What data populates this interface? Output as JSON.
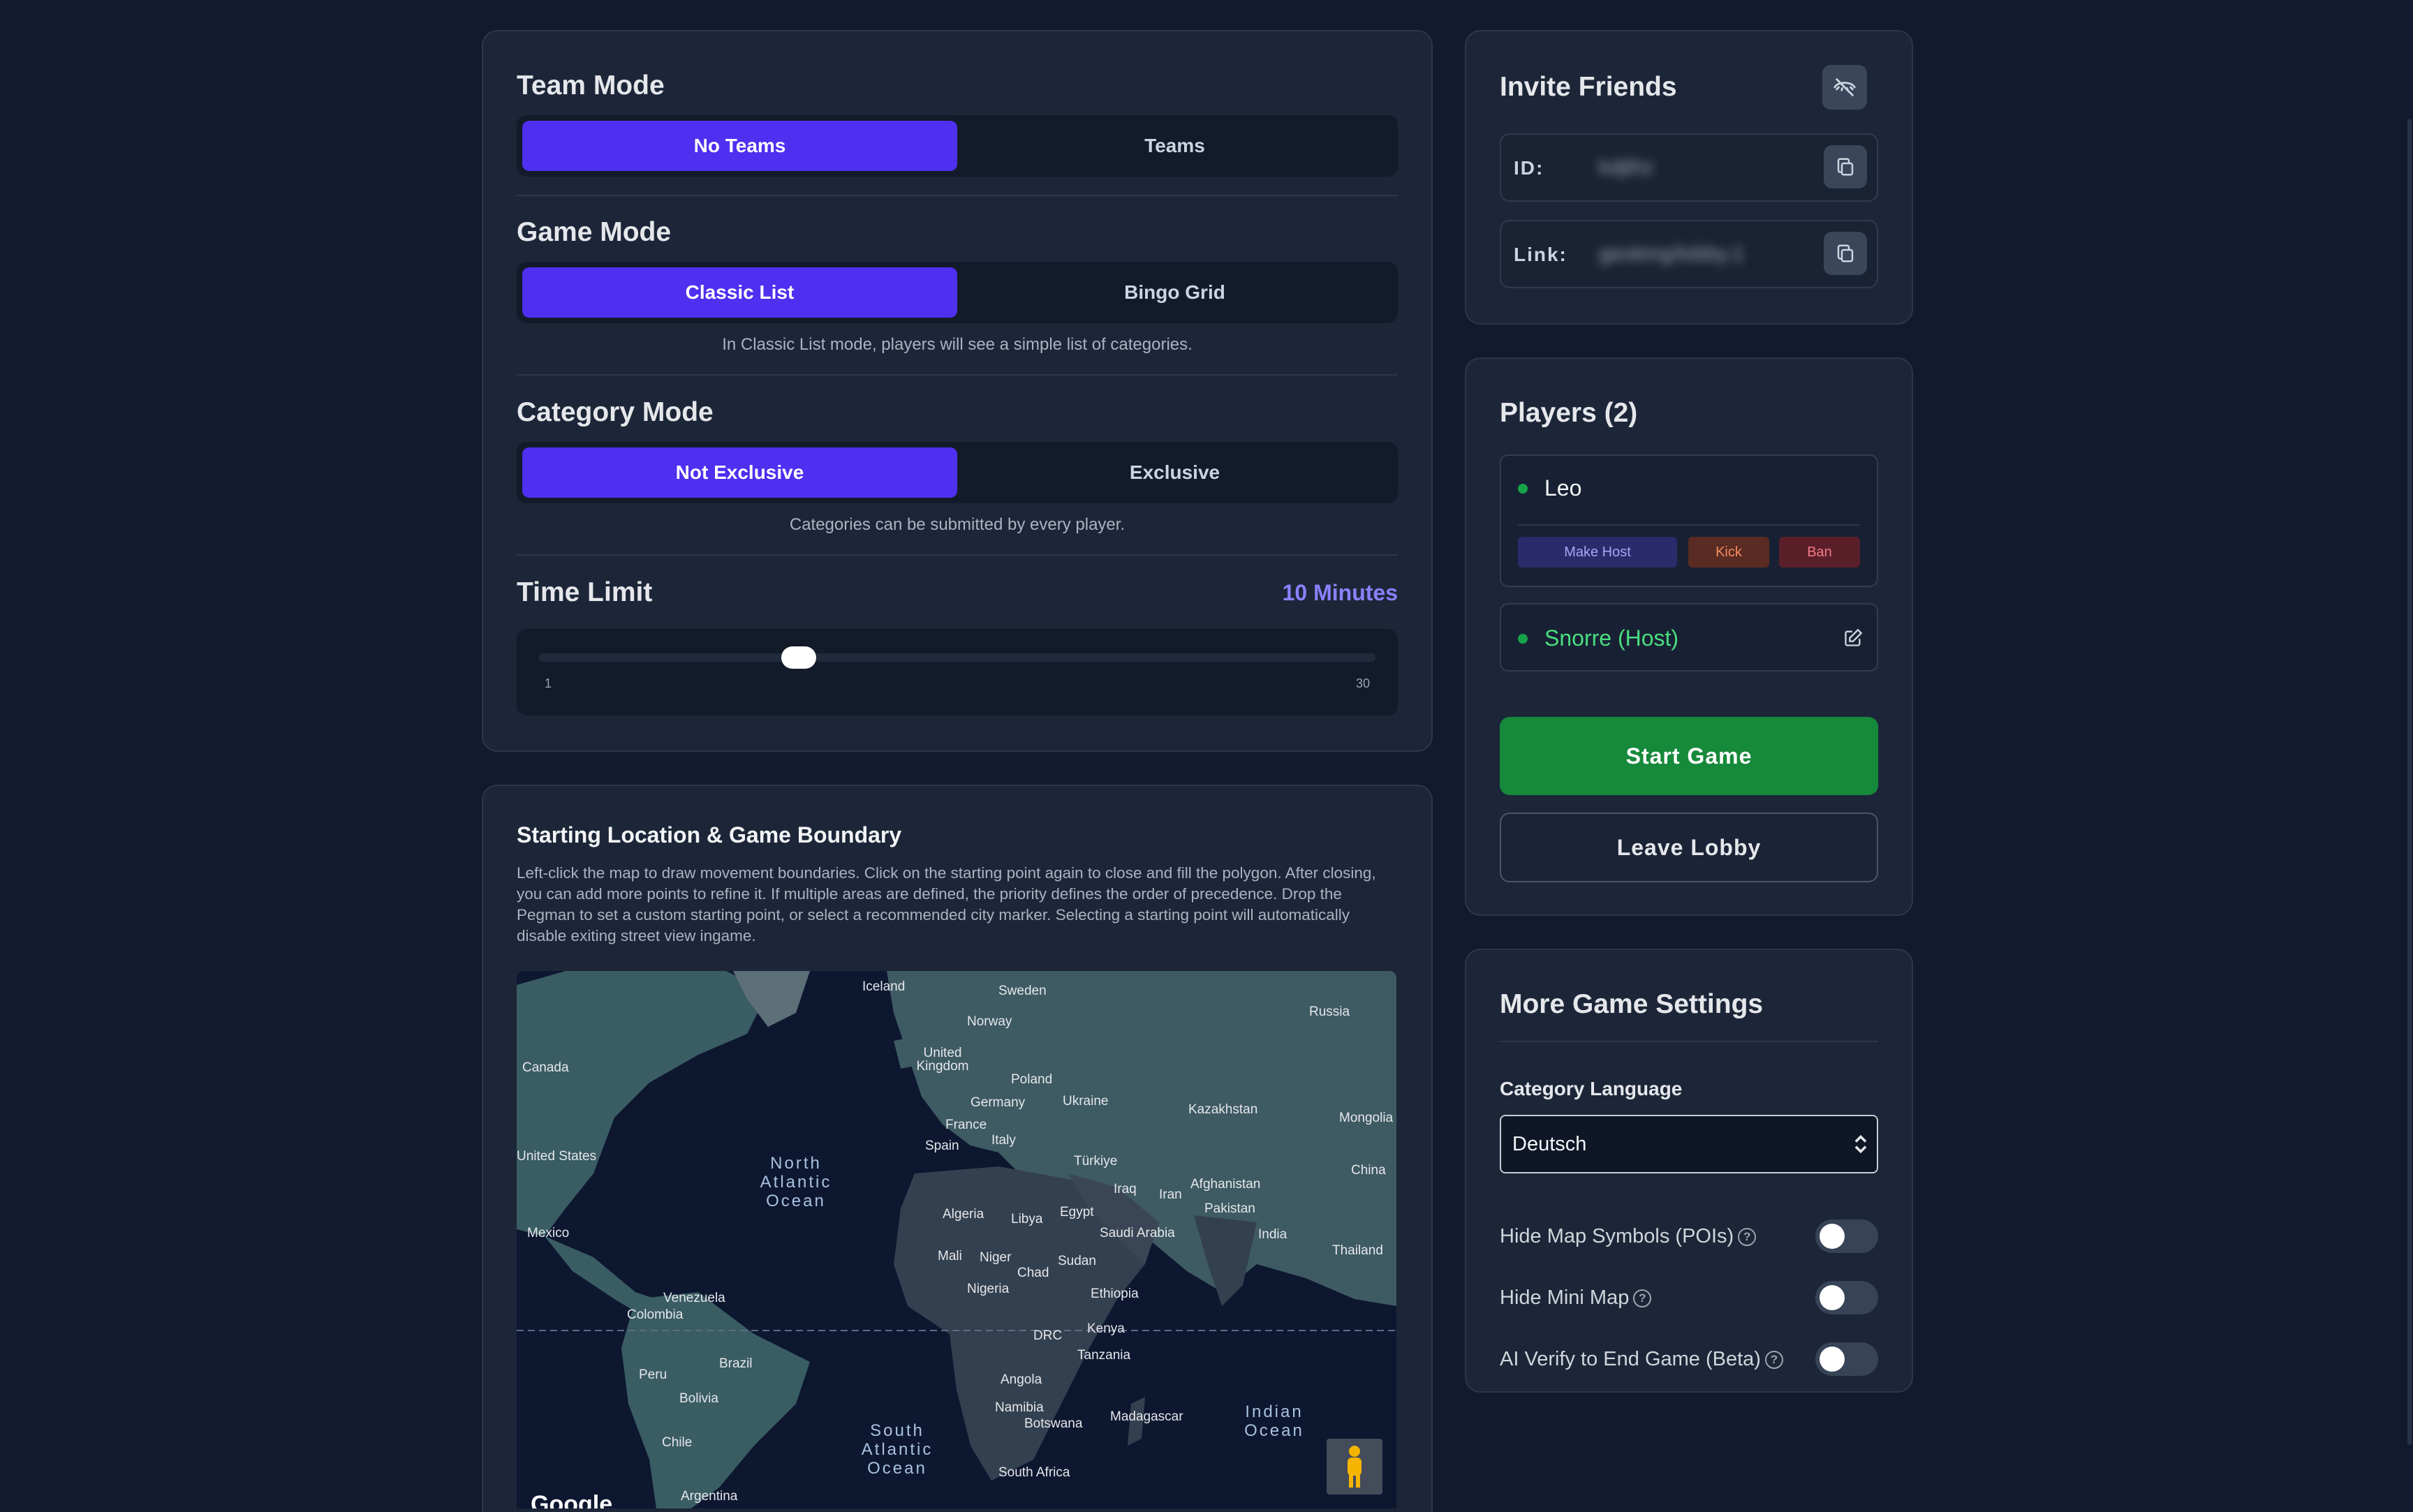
{
  "settings": {
    "team_mode": {
      "title": "Team Mode",
      "options": [
        "No Teams",
        "Teams"
      ]
    },
    "game_mode": {
      "title": "Game Mode",
      "options": [
        "Classic List",
        "Bingo Grid"
      ],
      "hint": "In Classic List mode, players will see a simple list of categories."
    },
    "category_mode": {
      "title": "Category Mode",
      "options": [
        "Not Exclusive",
        "Exclusive"
      ],
      "hint": "Categories can be submitted by every player."
    },
    "time_limit": {
      "title": "Time Limit",
      "value_label": "10 Minutes",
      "value": 10,
      "min_label": "1",
      "max_label": "30",
      "min": 1,
      "max": 30
    }
  },
  "map_section": {
    "title": "Starting Location & Game Boundary",
    "description": "Left-click the map to draw movement boundaries. Click on the starting point again to close and fill the polygon. After closing, you can add more points to refine it. If multiple areas are defined, the priority defines the order of precedence. Drop the Pegman to set a custom starting point, or select a recommended city marker. Selecting a starting point will automatically disable exiting street view ingame.",
    "labels": {
      "iceland": "Iceland",
      "sweden": "Sweden",
      "norway": "Norway",
      "russia": "Russia",
      "canada": "Canada",
      "uk": "United Kingdom",
      "poland": "Poland",
      "germany": "Germany",
      "ukraine": "Ukraine",
      "kazakhstan": "Kazakhstan",
      "france": "France",
      "mongolia": "Mongolia",
      "italy": "Italy",
      "spain": "Spain",
      "us": "United States",
      "turkiye": "Türkiye",
      "china": "China",
      "afghanistan": "Afghanistan",
      "iraq": "Iraq",
      "iran": "Iran",
      "algeria": "Algeria",
      "libya": "Libya",
      "egypt": "Egypt",
      "pakistan": "Pakistan",
      "mexico": "Mexico",
      "saudi": "Saudi Arabia",
      "india": "India",
      "thailand": "Thailand",
      "mali": "Mali",
      "niger": "Niger",
      "sudan": "Sudan",
      "chad": "Chad",
      "venezuela": "Venezuela",
      "nigeria": "Nigeria",
      "ethiopia": "Ethiopia",
      "colombia": "Colombia",
      "kenya": "Kenya",
      "drc": "DRC",
      "tanzania": "Tanzania",
      "brazil": "Brazil",
      "peru": "Peru",
      "angola": "Angola",
      "bolivia": "Bolivia",
      "namibia": "Namibia",
      "madagascar": "Madagascar",
      "botswana": "Botswana",
      "chile": "Chile",
      "south_africa": "South Africa",
      "argentina": "Argentina",
      "north_atlantic": "North Atlantic Ocean",
      "south_atlantic": "South Atlantic Ocean",
      "indian": "Indian Ocean",
      "google": "Google"
    }
  },
  "invite": {
    "title": "Invite Friends",
    "id_label": "ID:",
    "id_value": "kdjthz",
    "link_label": "Link:",
    "link_value": "geoking/lobby.1"
  },
  "players": {
    "title": "Players (2)",
    "list": [
      {
        "name": "Leo",
        "actions": [
          "Make Host",
          "Kick",
          "Ban"
        ]
      },
      {
        "name": "Snorre (Host)"
      }
    ],
    "start_label": "Start Game",
    "leave_label": "Leave Lobby"
  },
  "more_settings": {
    "title": "More Game Settings",
    "language_label": "Category Language",
    "language_value": "Deutsch",
    "toggles": [
      {
        "label": "Hide Map Symbols (POIs)",
        "on": false
      },
      {
        "label": "Hide Mini Map",
        "on": false
      },
      {
        "label": "AI Verify to End Game (Beta)",
        "on": false
      }
    ]
  },
  "colors": {
    "accent": "#4f2ff0",
    "start": "#16893a",
    "host": "#4ade80",
    "time_value": "#8b80ff"
  }
}
